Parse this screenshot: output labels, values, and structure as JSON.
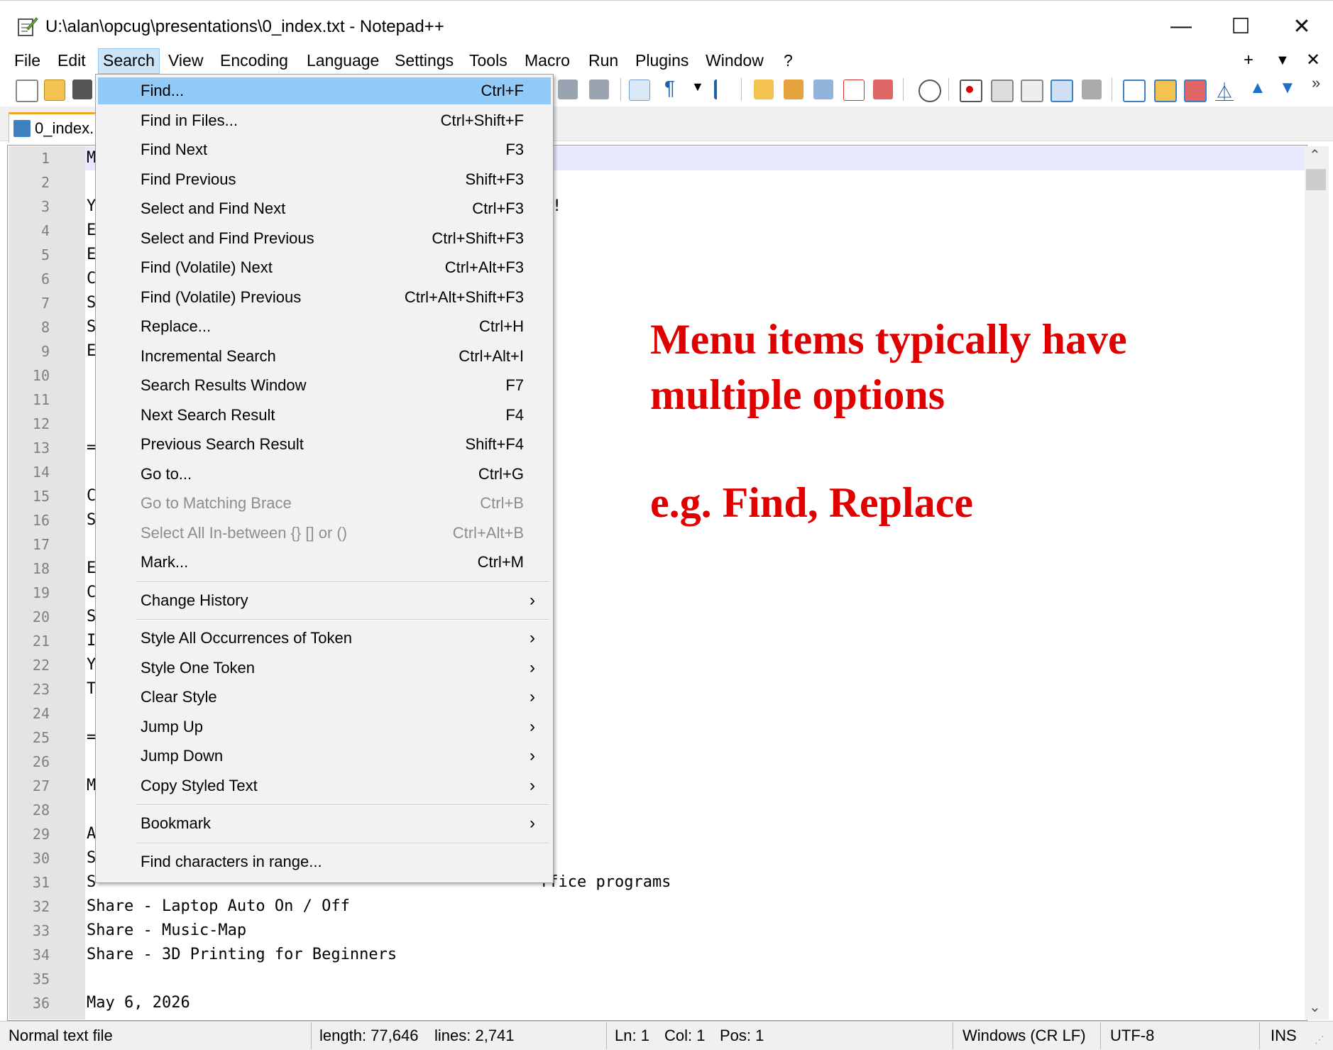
{
  "window": {
    "title": "U:\\alan\\opcug\\presentations\\0_index.txt - Notepad++",
    "minimize": "—",
    "maximize": "☐",
    "close": "✕"
  },
  "menubar": {
    "items": [
      "File",
      "Edit",
      "Search",
      "View",
      "Encoding",
      "Language",
      "Settings",
      "Tools",
      "Macro",
      "Run",
      "Plugins",
      "Window",
      "?"
    ],
    "active": "Search",
    "right_plus": "+",
    "right_down": "▼",
    "right_close": "✕"
  },
  "toolbar": {
    "overflow": "»"
  },
  "tab": {
    "label": "0_index."
  },
  "editor": {
    "line_numbers": [
      "1",
      "2",
      "3",
      "4",
      "5",
      "6",
      "7",
      "8",
      "9",
      "10",
      "11",
      "12",
      "13",
      "14",
      "15",
      "16",
      "17",
      "18",
      "19",
      "20",
      "21",
      "22",
      "23",
      "24",
      "25",
      "26",
      "27",
      "28",
      "29",
      "30",
      "31",
      "32",
      "33",
      "34",
      "35",
      "36"
    ],
    "visible_prefixes": [
      "M",
      "",
      "Y",
      "E",
      "E",
      "C",
      "S",
      "S",
      "E",
      "",
      "",
      "",
      "=",
      "",
      "C",
      "S",
      "",
      "E",
      "C",
      "S",
      "I",
      "Y",
      "T",
      "",
      "=",
      "",
      "M",
      "",
      "A",
      "S",
      "S",
      "",
      "",
      "",
      "",
      ""
    ],
    "partial_31": "ffice programs",
    "line_32": "Share - Laptop Auto On / Off",
    "line_33": "Share - Music-Map",
    "line_34": "Share - 3D Printing for Beginners",
    "line_36": "May 6, 2026",
    "line3_fragment": "!"
  },
  "search_menu": {
    "items": [
      {
        "label": "Find...",
        "shortcut": "Ctrl+F",
        "highlighted": true
      },
      {
        "label": "Find in Files...",
        "shortcut": "Ctrl+Shift+F"
      },
      {
        "label": "Find Next",
        "shortcut": "F3"
      },
      {
        "label": "Find Previous",
        "shortcut": "Shift+F3"
      },
      {
        "label": "Select and Find Next",
        "shortcut": "Ctrl+F3"
      },
      {
        "label": "Select and Find Previous",
        "shortcut": "Ctrl+Shift+F3"
      },
      {
        "label": "Find (Volatile) Next",
        "shortcut": "Ctrl+Alt+F3"
      },
      {
        "label": "Find (Volatile) Previous",
        "shortcut": "Ctrl+Alt+Shift+F3"
      },
      {
        "label": "Replace...",
        "shortcut": "Ctrl+H"
      },
      {
        "label": "Incremental Search",
        "shortcut": "Ctrl+Alt+I"
      },
      {
        "label": "Search Results Window",
        "shortcut": "F7"
      },
      {
        "label": "Next Search Result",
        "shortcut": "F4"
      },
      {
        "label": "Previous Search Result",
        "shortcut": "Shift+F4"
      },
      {
        "label": "Go to...",
        "shortcut": "Ctrl+G"
      },
      {
        "label": "Go to Matching Brace",
        "shortcut": "Ctrl+B",
        "disabled": true
      },
      {
        "label": "Select All In-between {} [] or ()",
        "shortcut": "Ctrl+Alt+B",
        "disabled": true
      },
      {
        "label": "Mark...",
        "shortcut": "Ctrl+M"
      },
      {
        "label": "Change History",
        "submenu": true
      },
      {
        "label": "Style All Occurrences of Token",
        "submenu": true
      },
      {
        "label": "Style One Token",
        "submenu": true
      },
      {
        "label": "Clear Style",
        "submenu": true
      },
      {
        "label": "Jump Up",
        "submenu": true
      },
      {
        "label": "Jump Down",
        "submenu": true
      },
      {
        "label": "Copy Styled Text",
        "submenu": true
      },
      {
        "label": "Bookmark",
        "submenu": true
      },
      {
        "label": "Find characters in range..."
      }
    ],
    "submenu_arrow": "›"
  },
  "annotation": {
    "line1": "Menu items typically have",
    "line2": "multiple options",
    "line3": "e.g.  Find, Replace"
  },
  "statusbar": {
    "file_type": "Normal text file",
    "length": "length: 77,646",
    "lines": "lines: 2,741",
    "ln": "Ln: 1",
    "col": "Col: 1",
    "pos": "Pos: 1",
    "eol": "Windows (CR LF)",
    "encoding": "UTF-8",
    "mode": "INS"
  },
  "colors": {
    "annotation": "#e00000",
    "menu_highlight": "#91c9f7",
    "gutter": "#e4e4e4"
  }
}
